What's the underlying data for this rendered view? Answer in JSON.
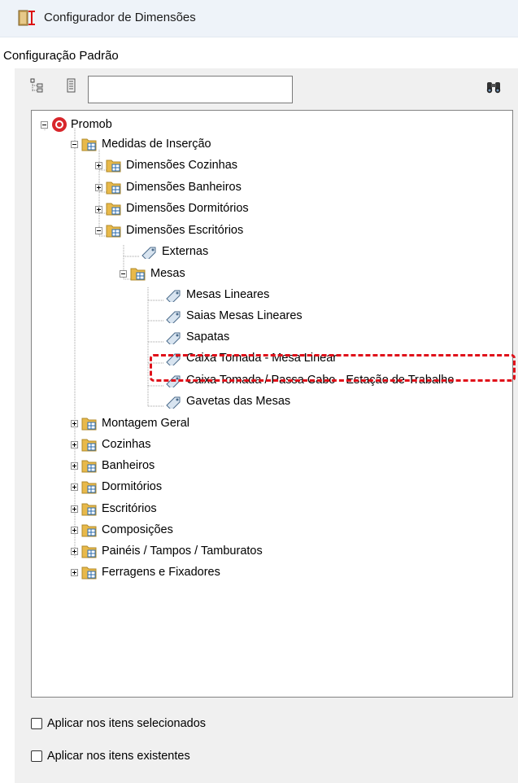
{
  "window": {
    "title": "Configurador de Dimensões"
  },
  "config_label": "Configuração Padrão",
  "toolbar": {
    "search_value": "",
    "expand_icon": "tree-expand-icon",
    "collapse_icon": "tree-collapse-icon",
    "find_icon": "binoculars-icon"
  },
  "tree": {
    "root": "Promob",
    "medidas": "Medidas de Inserção",
    "dim_cozinhas": "Dimensões Cozinhas",
    "dim_banheiros": "Dimensões Banheiros",
    "dim_dormitorios": "Dimensões Dormitórios",
    "dim_escritorios": "Dimensões Escritórios",
    "externas": "Externas",
    "mesas": "Mesas",
    "mesas_lineares": "Mesas Lineares",
    "saias": "Saias Mesas Lineares",
    "sapatas": "Sapatas",
    "caixa_mesa": "Caixa Tomada - Mesa Linear",
    "caixa_passa": "Caixa Tomada / Passa Cabo - Estação de Trabalho",
    "gavetas": "Gavetas das Mesas",
    "montagem": "Montagem Geral",
    "cozinhas": "Cozinhas",
    "banheiros": "Banheiros",
    "dormitorios": "Dormitórios",
    "escritorios": "Escritórios",
    "composicoes": "Composições",
    "paineis": "Painéis / Tampos / Tamburatos",
    "ferragens": "Ferragens e Fixadores"
  },
  "options": {
    "apply_selected": "Aplicar nos itens selecionados",
    "apply_existing": "Aplicar nos itens existentes"
  },
  "colors": {
    "highlight": "#e0111a",
    "folder": "#e8b94a",
    "accent": "#2b6cb0"
  }
}
